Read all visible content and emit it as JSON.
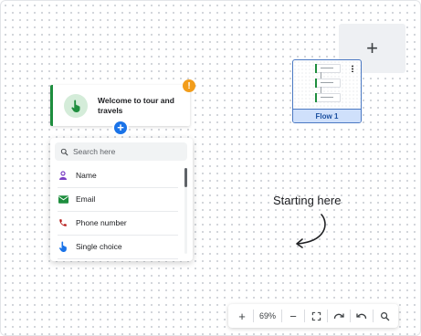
{
  "canvas": {
    "add_flow_icon": "plus-icon",
    "flow_thumbnail": {
      "label": "Flow 1"
    }
  },
  "node": {
    "title": "Welcome to tour and travels",
    "icon": "hand-pointer-icon",
    "warning_badge": "!",
    "accent_color": "#1e8e3e"
  },
  "dropdown": {
    "search_placeholder": "Search here",
    "options": [
      {
        "label": "Name",
        "icon": "person-icon",
        "color": "#7b3fc4"
      },
      {
        "label": "Email",
        "icon": "mail-icon",
        "color": "#1e8e3e"
      },
      {
        "label": "Phone number",
        "icon": "phone-icon",
        "color": "#b31412"
      },
      {
        "label": "Single choice",
        "icon": "single-choice-icon",
        "color": "#1a73e8"
      }
    ]
  },
  "annotation": {
    "text": "Starting here"
  },
  "toolbar": {
    "zoom_in": "+",
    "zoom_level": "69%",
    "zoom_out": "−"
  }
}
